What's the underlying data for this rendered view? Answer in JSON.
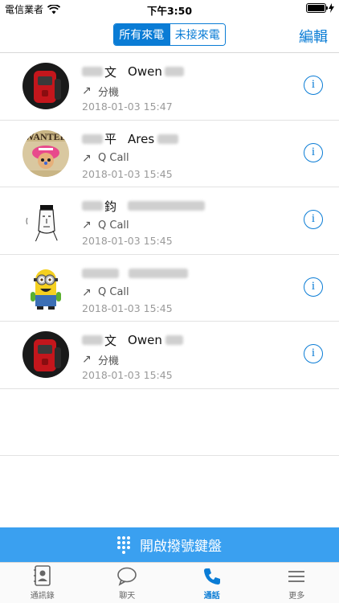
{
  "status_bar": {
    "carrier": "電信業者",
    "time": "下午3:50",
    "battery_level": 1.0
  },
  "nav": {
    "segments": [
      {
        "label": "所有來電",
        "active": true
      },
      {
        "label": "未接來電",
        "active": false
      }
    ],
    "edit_label": "編輯"
  },
  "calls": [
    {
      "name_char": "文",
      "name_en": "Owen",
      "type": "分機",
      "timestamp": "2018-01-03 15:47",
      "avatar": "red-phone"
    },
    {
      "name_char": "平",
      "name_en": "Ares",
      "type": "Q Call",
      "timestamp": "2018-01-03 15:45",
      "avatar": "wanted-poster"
    },
    {
      "name_char": "鈞",
      "name_en": "",
      "type": "Q Call",
      "timestamp": "2018-01-03 15:45",
      "avatar": "sketch-face"
    },
    {
      "name_char": "",
      "name_en": "",
      "type": "Q Call",
      "timestamp": "2018-01-03 15:45",
      "avatar": "minion"
    },
    {
      "name_char": "文",
      "name_en": "Owen",
      "type": "分機",
      "timestamp": "2018-01-03 15:45",
      "avatar": "red-phone"
    }
  ],
  "keypad_label": "開啟撥號鍵盤",
  "tabs": [
    {
      "label": "通訊錄",
      "icon": "contacts-icon",
      "active": false
    },
    {
      "label": "聊天",
      "icon": "chat-icon",
      "active": false
    },
    {
      "label": "通話",
      "icon": "phone-icon",
      "active": true
    },
    {
      "label": "更多",
      "icon": "more-icon",
      "active": false
    }
  ],
  "colors": {
    "accent": "#0a7cd5",
    "keypad_bar": "#3aa0f0"
  }
}
